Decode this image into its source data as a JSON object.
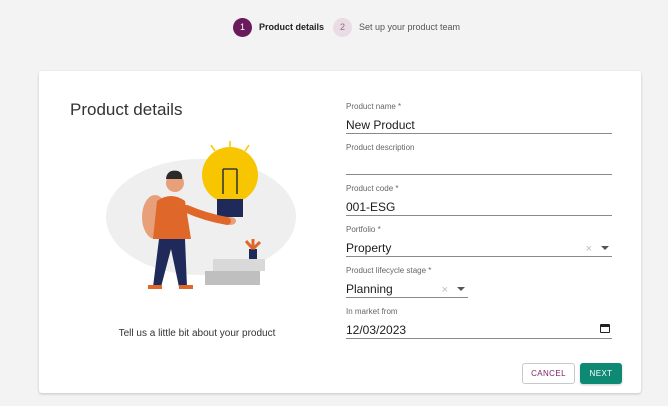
{
  "stepper": {
    "steps": [
      {
        "number": "1",
        "label": "Product details"
      },
      {
        "number": "2",
        "label": "Set up your product team"
      }
    ]
  },
  "card": {
    "title": "Product details",
    "tagline": "Tell us a little bit about your product"
  },
  "form": {
    "product_name": {
      "label": "Product name *",
      "value": "New Product"
    },
    "product_description": {
      "label": "Product description",
      "value": ""
    },
    "product_code": {
      "label": "Product code *",
      "value": "001-ESG"
    },
    "portfolio": {
      "label": "Portfolio *",
      "value": "Property",
      "clear": "×"
    },
    "lifecycle_stage": {
      "label": "Product lifecycle stage *",
      "value": "Planning",
      "clear": "×"
    },
    "in_market_from": {
      "label": "In market from",
      "value": "12/03/2023"
    }
  },
  "actions": {
    "cancel_label": "CANCEL",
    "next_label": "NEXT"
  },
  "colors": {
    "active_step": "#6a1b5c",
    "inactive_step": "#eadbe5",
    "primary_button": "#0e8a74",
    "cancel_text": "#7a1f66",
    "bulb": "#f7c600"
  },
  "icons": {
    "calendar": "calendar-icon",
    "dropdown": "chevron-down-icon",
    "clear": "clear-icon",
    "illustration": "person-holding-lightbulb"
  }
}
